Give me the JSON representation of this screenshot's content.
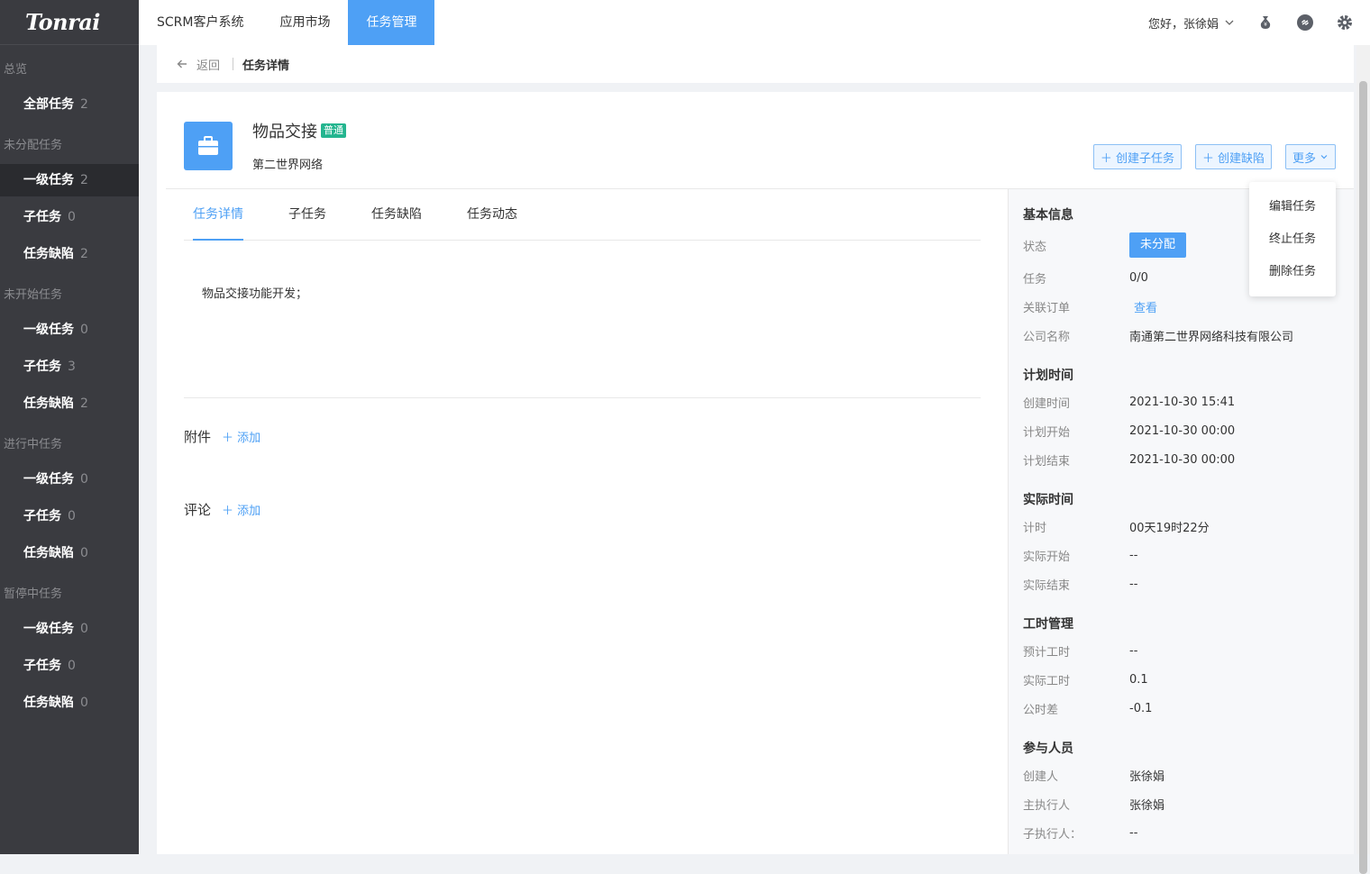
{
  "logo": "Tonrai",
  "sidebar": {
    "sections": [
      {
        "title": "总览",
        "items": [
          {
            "label": "全部任务",
            "count": "2"
          }
        ]
      },
      {
        "title": "未分配任务",
        "items": [
          {
            "label": "一级任务",
            "count": "2"
          },
          {
            "label": "子任务",
            "count": "0"
          },
          {
            "label": "任务缺陷",
            "count": "2"
          }
        ]
      },
      {
        "title": "未开始任务",
        "items": [
          {
            "label": "一级任务",
            "count": "0"
          },
          {
            "label": "子任务",
            "count": "3"
          },
          {
            "label": "任务缺陷",
            "count": "2"
          }
        ]
      },
      {
        "title": "进行中任务",
        "items": [
          {
            "label": "一级任务",
            "count": "0"
          },
          {
            "label": "子任务",
            "count": "0"
          },
          {
            "label": "任务缺陷",
            "count": "0"
          }
        ]
      },
      {
        "title": "暂停中任务",
        "items": [
          {
            "label": "一级任务",
            "count": "0"
          },
          {
            "label": "子任务",
            "count": "0"
          },
          {
            "label": "任务缺陷",
            "count": "0"
          }
        ]
      }
    ]
  },
  "topnav": {
    "items": [
      "SCRM客户系统",
      "应用市场",
      "任务管理"
    ],
    "greeting": "您好，张徐娟"
  },
  "breadcrumb": {
    "back": "返回",
    "current": "任务详情"
  },
  "task": {
    "title": "物品交接",
    "tag": "普通",
    "subtitle": "第二世界网络",
    "btn_subtask": "创建子任务",
    "btn_defect": "创建缺陷",
    "btn_more": "更多",
    "description": "物品交接功能开发；"
  },
  "tabs": [
    "任务详情",
    "子任务",
    "任务缺陷",
    "任务动态"
  ],
  "attach": {
    "label": "附件",
    "add": "添加"
  },
  "comment": {
    "label": "评论",
    "add": "添加"
  },
  "dropdown": [
    "编辑任务",
    "终止任务",
    "删除任务"
  ],
  "info": {
    "basic_title": "基本信息",
    "status_label": "状态",
    "status_value": "未分配",
    "task_label": "任务",
    "task_value": "0/0",
    "order_label": "关联订单",
    "order_value": "查看",
    "company_label": "公司名称",
    "company_value": "南通第二世界网络科技有限公司",
    "plan_title": "计划时间",
    "created_label": "创建时间",
    "created_value": "2021-10-30 15:41",
    "plan_start_label": "计划开始",
    "plan_start_value": "2021-10-30 00:00",
    "plan_end_label": "计划结束",
    "plan_end_value": "2021-10-30 00:00",
    "actual_title": "实际时间",
    "timer_label": "计时",
    "timer_value": "00天19时22分",
    "actual_start_label": "实际开始",
    "actual_start_value": "--",
    "actual_end_label": "实际结束",
    "actual_end_value": "--",
    "hours_title": "工时管理",
    "est_label": "预计工时",
    "est_value": "--",
    "real_label": "实际工时",
    "real_value": "0.1",
    "diff_label": "公时差",
    "diff_value": "-0.1",
    "people_title": "参与人员",
    "creator_label": "创建人",
    "creator_value": "张徐娟",
    "owner_label": "主执行人",
    "owner_value": "张徐娟",
    "sub_label": "子执行人：",
    "sub_value": "--"
  }
}
